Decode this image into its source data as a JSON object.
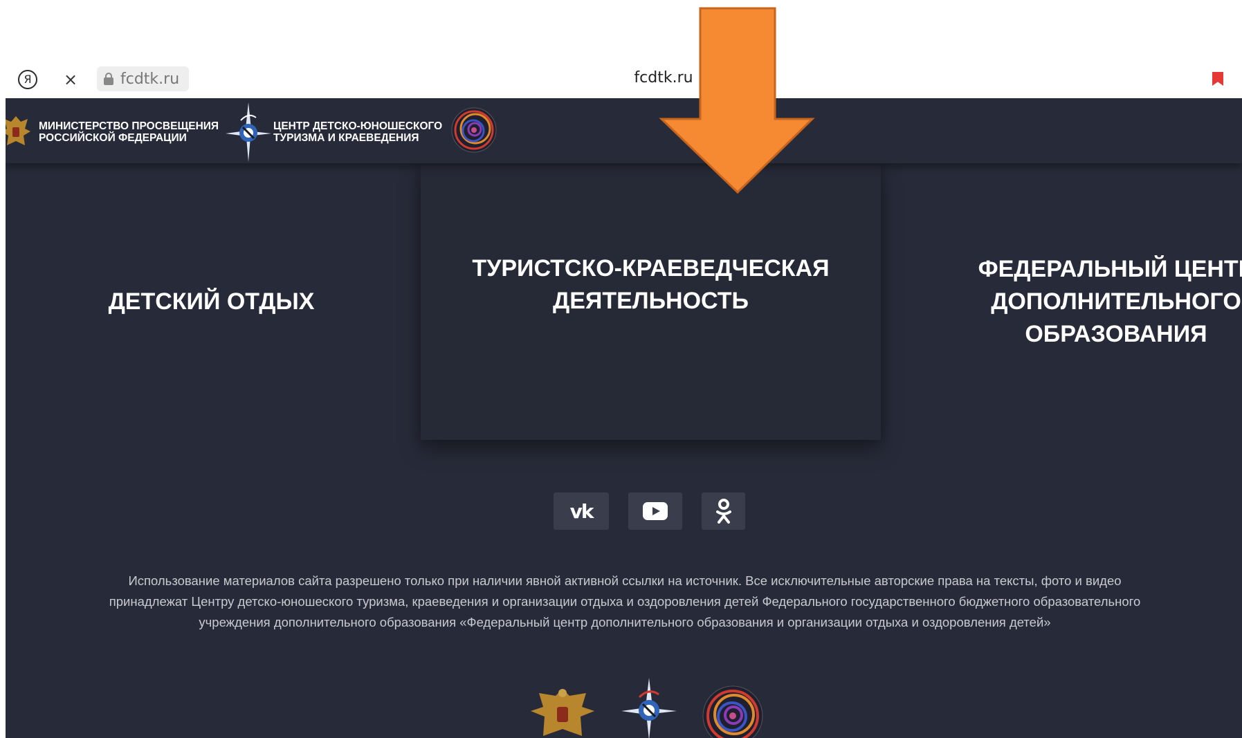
{
  "browser": {
    "yandex_glyph": "Я",
    "close_glyph": "×",
    "url": "fcdtk.ru",
    "page_title": "fcdtk.ru",
    "bookmark_color": "#e53935"
  },
  "header": {
    "ministry_text": "МИНИСТЕРСТВО ПРОСВЕЩЕНИЯ\nРОССИЙСКОЙ ФЕДЕРАЦИИ",
    "center_text": "ЦЕНТР ДЕТСКО-ЮНОШЕСКОГО\nТУРИЗМА И КРАЕВЕДЕНИЯ",
    "icons": [
      "eagle-emblem-icon",
      "compass-logo-icon",
      "swirl-logo-icon"
    ]
  },
  "cards": [
    {
      "label": "ДЕТСКИЙ ОТДЫХ"
    },
    {
      "label": "ТУРИСТСКО-КРАЕВЕДЧЕСКАЯ\nДЕЯТЕЛЬНОСТЬ"
    },
    {
      "label": "ФЕДЕРАЛЬНЫЙ ЦЕНТР\nДОПОЛНИТЕЛЬНОГО\nОБРАЗОВАНИЯ"
    }
  ],
  "social": {
    "vk_label": "vk",
    "youtube_icon": "youtube-icon",
    "ok_icon": "odnoklassniki-icon"
  },
  "footer": {
    "copyright": "Использование материалов сайта разрешено только при наличии явной активной ссылки на источник. Все исключительные авторские права на тексты, фото и видео принадлежат Центру детско-юношеского туризма, краеведения и организации отдыха и оздоровления детей Федерального государственного бюджетного образовательного учреждения дополнительного образования «Федеральный центр дополнительного образования и организации отдыха и оздоровления детей»"
  },
  "colors": {
    "site_bg": "#272a38",
    "card_highlight_bg": "#262936",
    "social_btn_bg": "#3a3d4b",
    "footer_text": "#c9cad0",
    "arrow_fill": "#f68a33",
    "arrow_stroke": "#c7641d"
  }
}
